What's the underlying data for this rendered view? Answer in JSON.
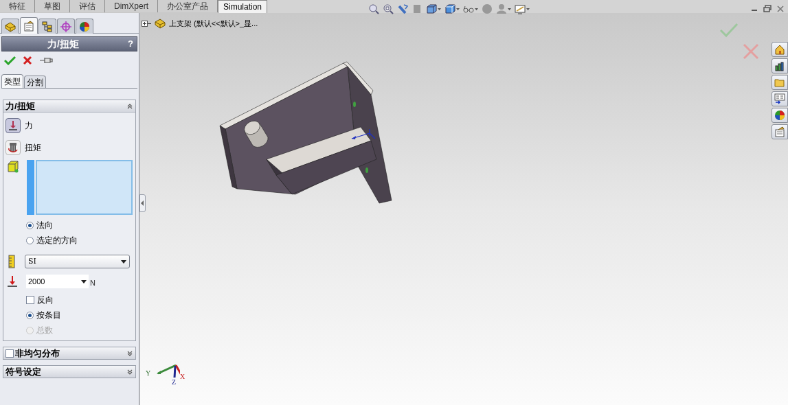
{
  "command_tabs": [
    {
      "label": "特征",
      "selected": false
    },
    {
      "label": "草图",
      "selected": false
    },
    {
      "label": "评估",
      "selected": false
    },
    {
      "label": "DimXpert",
      "selected": false
    },
    {
      "label": "办公室产品",
      "selected": false
    },
    {
      "label": "Simulation",
      "selected": true
    }
  ],
  "panel_tabs": [
    {
      "kind": "feature",
      "selected": false
    },
    {
      "kind": "property",
      "selected": true
    },
    {
      "kind": "config",
      "selected": false
    },
    {
      "kind": "dimxpert",
      "selected": false
    },
    {
      "kind": "display",
      "selected": false
    }
  ],
  "property_manager": {
    "title": "力/扭矩",
    "help": "?"
  },
  "sub_tabs": [
    {
      "label": "类型",
      "selected": true
    },
    {
      "label": "分割",
      "selected": false
    }
  ],
  "group": {
    "title": "力/扭矩",
    "expanded": true,
    "types": [
      {
        "kind": "force",
        "label": "力",
        "selected": true
      },
      {
        "kind": "torque",
        "label": "扭矩",
        "selected": false
      }
    ],
    "direction": [
      {
        "label": "法向",
        "selected": true
      },
      {
        "label": "选定的方向",
        "selected": false
      }
    ],
    "unit_system": "SI",
    "force_value": "2000",
    "force_unit": "N",
    "reverse": {
      "label": "反向",
      "checked": false
    },
    "distribution": [
      {
        "label": "按条目",
        "selected": true,
        "disabled": false
      },
      {
        "label": "总数",
        "selected": false,
        "disabled": true
      }
    ]
  },
  "sections": [
    {
      "kind": "checkbox",
      "title": "非均匀分布",
      "checked": false,
      "expanded": false
    },
    {
      "kind": "plain",
      "title": "符号设定",
      "expanded": false
    }
  ],
  "tree": {
    "label": "上支架 (默认<<默认>_显..."
  },
  "triad": {
    "x": "X",
    "y": "Y",
    "z": "Z"
  }
}
